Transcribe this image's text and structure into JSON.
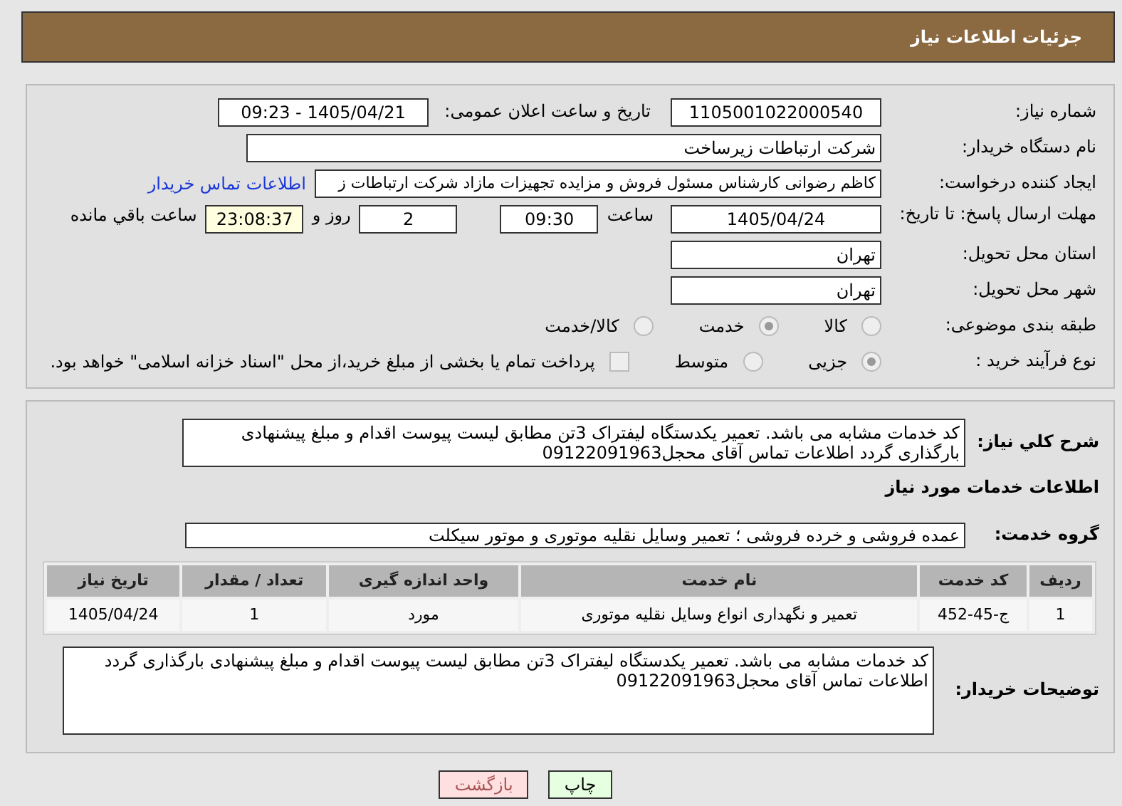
{
  "header": {
    "title": "جزئیات اطلاعات نیاز"
  },
  "need_number": {
    "label": "شماره نیاز:",
    "value": "1105001022000540"
  },
  "announce": {
    "label": "تاریخ و ساعت اعلان عمومی:",
    "value": "1405/04/21 - 09:23"
  },
  "buyer": {
    "label": "نام دستگاه خریدار:",
    "value": "شرکت ارتباطات زیرساخت"
  },
  "requester": {
    "label": "ایجاد کننده درخواست:",
    "value": "کاظم رضوانی کارشناس مسئول فروش و مزایده تجهیزات مازاد شرکت ارتباطات ز",
    "link": "اطلاعات تماس خریدار"
  },
  "deadline": {
    "label": "مهلت ارسال پاسخ: تا تاریخ:",
    "date": "1405/04/24",
    "time_label": "ساعت",
    "time": "09:30",
    "days": "2",
    "days_label": "روز و",
    "remaining": "23:08:37",
    "remaining_label": "ساعت باقي مانده"
  },
  "province": {
    "label": "استان محل تحویل:",
    "value": "تهران"
  },
  "city": {
    "label": "شهر محل تحویل:",
    "value": "تهران"
  },
  "category": {
    "label": "طبقه بندی موضوعی:",
    "options": [
      {
        "label": "کالا",
        "selected": false
      },
      {
        "label": "خدمت",
        "selected": true
      },
      {
        "label": "کالا/خدمت",
        "selected": false
      }
    ]
  },
  "process": {
    "label": "نوع فرآیند خرید :",
    "options": [
      {
        "label": "جزیی",
        "selected": true
      },
      {
        "label": "متوسط",
        "selected": false
      }
    ],
    "checkbox": {
      "label": "پرداخت تمام یا بخشی از مبلغ خرید،از محل \"اسناد خزانه اسلامی\" خواهد بود.",
      "checked": false
    }
  },
  "description": {
    "label": "شرح کلي نیاز:",
    "value": "کد خدمات مشابه می باشد. تعمیر یکدستگاه لیفتراک 3تن مطابق لیست پیوست اقدام و مبلغ پیشنهادی بارگذاری گردد اطلاعات تماس آقای محجل09122091963"
  },
  "services_heading": "اطلاعات خدمات مورد نیاز",
  "service_group": {
    "label": "گروه خدمت:",
    "value": "عمده فروشی و خرده فروشی ؛ تعمیر وسایل نقلیه موتوری و موتور سیکلت"
  },
  "table": {
    "columns": [
      "ردیف",
      "کد خدمت",
      "نام خدمت",
      "واحد اندازه گیری",
      "تعداد / مقدار",
      "تاریخ نیاز"
    ],
    "rows": [
      [
        "1",
        "ج-45-452",
        "تعمیر و نگهداری انواع وسایل نقلیه موتوری",
        "مورد",
        "1",
        "1405/04/24"
      ]
    ]
  },
  "buyer_notes": {
    "label": "توضیحات خریدار:",
    "value": "کد خدمات مشابه می باشد. تعمیر یکدستگاه لیفتراک 3تن مطابق لیست پیوست اقدام و مبلغ پیشنهادی بارگذاری گردد اطلاعات تماس آقای محجل09122091963"
  },
  "buttons": [
    {
      "label": "چاپ",
      "kind": "print"
    },
    {
      "label": "بازگشت",
      "kind": "back"
    }
  ]
}
